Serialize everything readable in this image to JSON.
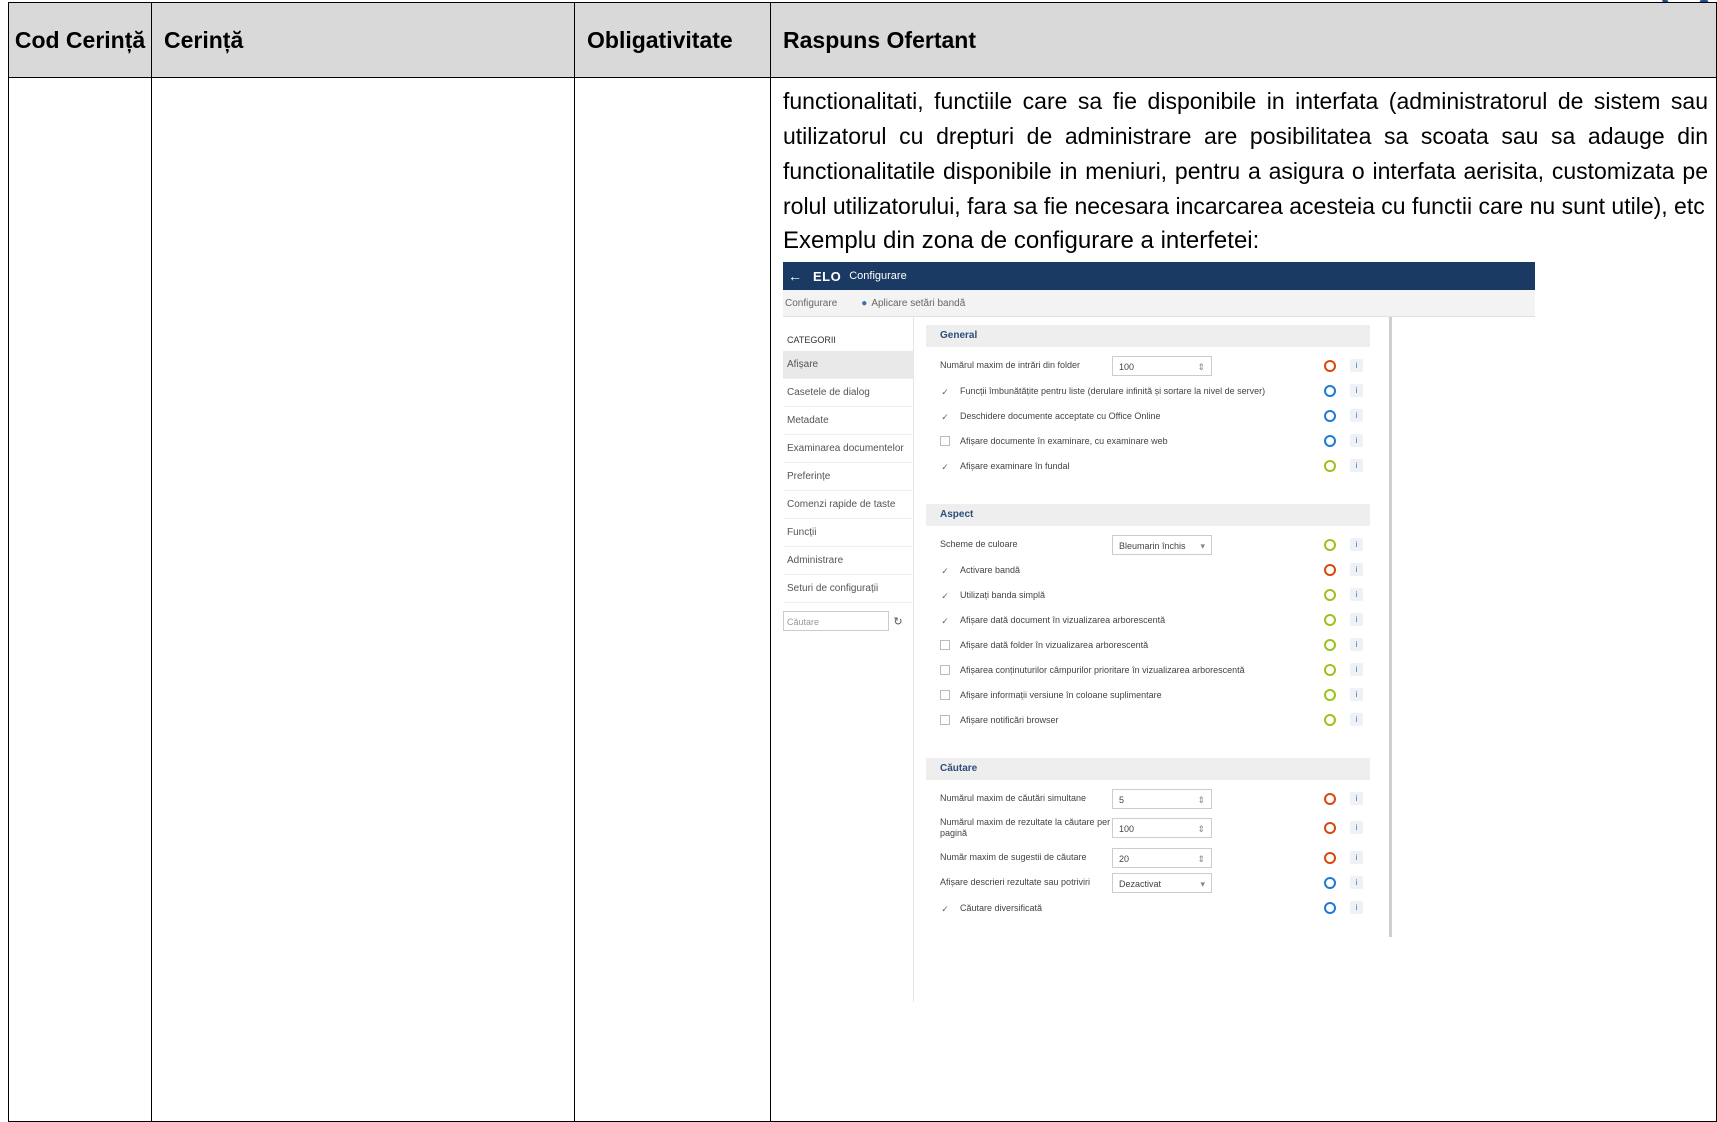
{
  "table": {
    "headers": {
      "code": "Cod Cerință",
      "requirement": "Cerință",
      "mandatory": "Obligativitate",
      "response": "Raspuns Ofertant"
    },
    "response_paragraph": "functionalitati, functiile care sa fie disponibile in interfata (administratorul de sistem sau utilizatorul cu drepturi de administrare are posibilitatea sa scoata sau sa adauge din functionalitatile disponibile in meniuri, pentru a asigura o interfata aerisita, customizata pe rolul utilizatorului, fara sa fie necesara incarcarea acesteia cu functii care nu sunt utile), etc",
    "example_label": "Exemplu din zona de configurare a interfetei:"
  },
  "screenshot": {
    "topbar": {
      "back": "←",
      "brand": "ELO",
      "title": "Configurare"
    },
    "breadcrumb": {
      "root": "Configurare",
      "action": "Aplicare setări bandă"
    },
    "sidebar": {
      "heading": "CATEGORII",
      "items": [
        "Afișare",
        "Casetele de dialog",
        "Metadate",
        "Examinarea documentelor",
        "Preferințe",
        "Comenzi rapide de taste",
        "Funcții",
        "Administrare",
        "Seturi de configurații"
      ],
      "active_index": 0,
      "search_placeholder": "Căutare"
    },
    "sections": [
      {
        "title": "General",
        "rows": [
          {
            "type": "number",
            "label": "Numărul maxim de intrări din folder",
            "value": "100",
            "indicator": "red"
          },
          {
            "type": "check",
            "checked": true,
            "label": "Funcții îmbunătățite pentru liste (derulare infinită și sortare la nivel de server)",
            "indicator": "blue"
          },
          {
            "type": "check",
            "checked": true,
            "label": "Deschidere documente acceptate cu Office Online",
            "indicator": "blue"
          },
          {
            "type": "check",
            "checked": false,
            "label": "Afișare documente în examinare, cu examinare web",
            "indicator": "blue"
          },
          {
            "type": "check",
            "checked": true,
            "label": "Afișare examinare în fundal",
            "indicator": "green"
          }
        ]
      },
      {
        "title": "Aspect",
        "rows": [
          {
            "type": "select",
            "label": "Scheme de culoare",
            "value": "Bleumarin închis",
            "indicator": "green"
          },
          {
            "type": "check",
            "checked": true,
            "label": "Activare bandă",
            "indicator": "red"
          },
          {
            "type": "check",
            "checked": true,
            "label": "Utilizați banda simplă",
            "indicator": "green"
          },
          {
            "type": "check",
            "checked": true,
            "label": "Afișare dată document în vizualizarea arborescentă",
            "indicator": "green"
          },
          {
            "type": "check",
            "checked": false,
            "label": "Afișare dată folder în vizualizarea arborescentă",
            "indicator": "green"
          },
          {
            "type": "check",
            "checked": false,
            "label": "Afișarea conținuturilor câmpurilor prioritare în vizualizarea arborescentă",
            "indicator": "green"
          },
          {
            "type": "check",
            "checked": false,
            "label": "Afișare informații versiune în coloane suplimentare",
            "indicator": "green"
          },
          {
            "type": "check",
            "checked": false,
            "label": "Afișare notificări browser",
            "indicator": "green"
          }
        ]
      },
      {
        "title": "Căutare",
        "rows": [
          {
            "type": "number",
            "label": "Numărul maxim de căutări simultane",
            "value": "5",
            "indicator": "red"
          },
          {
            "type": "number",
            "label": "Numărul maxim de rezultate la căutare per pagină",
            "value": "100",
            "indicator": "red",
            "tall": true
          },
          {
            "type": "number",
            "label": "Număr maxim de sugestii de căutare",
            "value": "20",
            "indicator": "red"
          },
          {
            "type": "select",
            "label": "Afișare descrieri rezultate sau potriviri",
            "value": "Dezactivat",
            "indicator": "blue"
          },
          {
            "type": "check",
            "checked": true,
            "label": "Căutare diversificată",
            "indicator": "blue"
          }
        ]
      }
    ],
    "colors": {
      "red": "#d9480f",
      "blue": "#1f7ad6",
      "green": "#9cc21c",
      "topbar": "#1a3a63"
    }
  }
}
